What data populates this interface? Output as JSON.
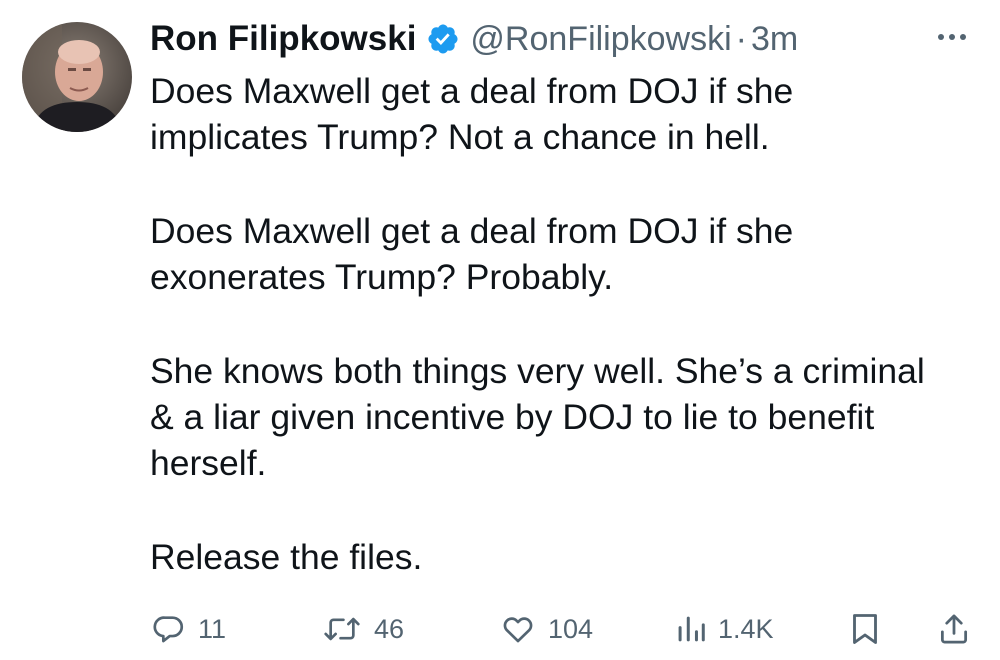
{
  "author": {
    "name": "Ron Filipkowski",
    "handle": "@RonFilipkowski",
    "separator": "·",
    "time": "3m",
    "verified": true,
    "avatar_icon": "profile-photo"
  },
  "menu_icon": "more-horizontal-icon",
  "tweet": {
    "paragraphs": [
      {
        "lines": [
          "Does Maxwell get a deal from DOJ if she",
          "implicates Trump? Not a chance in hell."
        ]
      },
      {
        "lines": [
          "Does Maxwell get a deal from DOJ if she",
          "exonerates Trump? Probably."
        ]
      },
      {
        "lines": [
          "She knows both things very well. She’s a criminal",
          "& a liar given incentive by DOJ to lie to benefit",
          "herself."
        ]
      },
      {
        "lines": [
          "Release the files."
        ]
      }
    ]
  },
  "actions": {
    "reply": {
      "icon": "reply-icon",
      "count": "11"
    },
    "retweet": {
      "icon": "retweet-icon",
      "count": "46"
    },
    "like": {
      "icon": "like-icon",
      "count": "104"
    },
    "views": {
      "icon": "views-icon",
      "count": "1.4K"
    },
    "bookmark": {
      "icon": "bookmark-icon"
    },
    "share": {
      "icon": "share-icon"
    }
  },
  "colors": {
    "text": "#0f1419",
    "secondary": "#536471",
    "verified": "#1d9bf0"
  }
}
